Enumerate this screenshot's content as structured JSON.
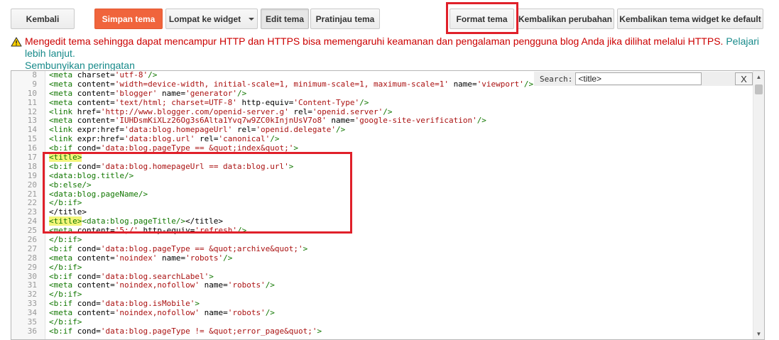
{
  "toolbar": {
    "back": "Kembali",
    "save": "Simpan tema",
    "jump": "Lompat ke widget",
    "edit": "Edit tema",
    "preview": "Pratinjau tema",
    "format": "Format tema",
    "revert": "Kembalikan perubahan",
    "reset_widgets": "Kembalikan tema widget ke default"
  },
  "warning": {
    "text": "Mengedit tema sehingga dapat mencampur HTTP dan HTTPS bisa memengaruhi keamanan dan pengalaman pengguna blog Anda jika dilihat melalui HTTPS.",
    "learn_more": "Pelajari lebih lanjut.",
    "hide": "Sembunyikan peringatan",
    "icon": "warning-triangle-icon"
  },
  "search": {
    "label": "Search:",
    "value": "<title>",
    "close": "X"
  },
  "lines": [
    {
      "n": "8",
      "html": "<span class='t'>&lt;meta</span> <span class='a'>charset=</span><span class='s'>'utf-8'</span><span class='t'>/&gt;</span>"
    },
    {
      "n": "9",
      "html": "<span class='t'>&lt;meta</span> <span class='a'>content=</span><span class='s'>'width=device-width, initial-scale=1, minimum-scale=1, maximum-scale=1'</span> <span class='a'>name=</span><span class='s'>'viewport'</span><span class='t'>/&gt;</span>"
    },
    {
      "n": "10",
      "html": "<span class='t'>&lt;meta</span> <span class='a'>content=</span><span class='s'>'blogger'</span> <span class='a'>name=</span><span class='s'>'generator'</span><span class='t'>/&gt;</span>"
    },
    {
      "n": "11",
      "html": "<span class='t'>&lt;meta</span> <span class='a'>content=</span><span class='s'>'text/html; charset=UTF-8'</span> <span class='a'>http-equiv=</span><span class='s'>'Content-Type'</span><span class='t'>/&gt;</span>"
    },
    {
      "n": "12",
      "html": "<span class='t'>&lt;link</span> <span class='a'>href=</span><span class='s'>'http://www.blogger.com/openid-server.g'</span> <span class='a'>rel=</span><span class='s'>'openid.server'</span><span class='t'>/&gt;</span>"
    },
    {
      "n": "13",
      "html": "<span class='t'>&lt;meta</span> <span class='a'>content=</span><span class='s'>'IUHDsmKiXLz26Og3s6Alta1Yvq7w9ZC0kInjnUsV7o8'</span> <span class='a'>name=</span><span class='s'>'google-site-verification'</span><span class='t'>/&gt;</span>"
    },
    {
      "n": "14",
      "html": "<span class='t'>&lt;link</span> <span class='a'>expr:href=</span><span class='s'>'data:blog.homepageUrl'</span> <span class='a'>rel=</span><span class='s'>'openid.delegate'</span><span class='t'>/&gt;</span>"
    },
    {
      "n": "15",
      "html": "<span class='t'>&lt;link</span> <span class='a'>expr:href=</span><span class='s'>'data:blog.url'</span> <span class='a'>rel=</span><span class='s'>'canonical'</span><span class='t'>/&gt;</span>"
    },
    {
      "n": "16",
      "html": "<span class='t'>&lt;b:if</span> <span class='a'>cond=</span><span class='s'>'data:blog.pageType == &amp;quot;index&amp;quot;'</span><span class='t'>&gt;</span>"
    },
    {
      "n": "17",
      "html": "<span class='t hl'>&lt;title&gt;</span>"
    },
    {
      "n": "18",
      "html": "<span class='t'>&lt;b:if</span> <span class='a'>cond=</span><span class='s'>'data:blog.homepageUrl == data:blog.url'</span><span class='t'>&gt;</span>"
    },
    {
      "n": "19",
      "html": "<span class='t'>&lt;data:blog.title/&gt;</span>"
    },
    {
      "n": "20",
      "html": "<span class='t'>&lt;b:else/&gt;</span>"
    },
    {
      "n": "21",
      "html": "<span class='t'>&lt;data:blog.pageName/&gt;</span>"
    },
    {
      "n": "22",
      "html": "<span class='t'>&lt;/b:if&gt;</span>"
    },
    {
      "n": "23",
      "html": "<span class='a'>&lt;/title&gt;</span>"
    },
    {
      "n": "24",
      "html": "<span class='t hl'>&lt;title&gt;</span><span class='t'>&lt;data:blog.pageTitle/&gt;</span><span class='a'>&lt;/title&gt;</span>"
    },
    {
      "n": "25",
      "html": "<span class='t'>&lt;meta</span> <span class='a'>content=</span><span class='s'>'5;/'</span> <span class='a'>http-equiv=</span><span class='s'>'refresh'</span><span class='t'>/&gt;</span>"
    },
    {
      "n": "26",
      "html": "<span class='t'>&lt;/b:if&gt;</span>"
    },
    {
      "n": "27",
      "html": "<span class='t'>&lt;b:if</span> <span class='a'>cond=</span><span class='s'>'data:blog.pageType == &amp;quot;archive&amp;quot;'</span><span class='t'>&gt;</span>"
    },
    {
      "n": "28",
      "html": "<span class='t'>&lt;meta</span> <span class='a'>content=</span><span class='s'>'noindex'</span> <span class='a'>name=</span><span class='s'>'robots'</span><span class='t'>/&gt;</span>"
    },
    {
      "n": "29",
      "html": "<span class='t'>&lt;/b:if&gt;</span>"
    },
    {
      "n": "30",
      "html": "<span class='t'>&lt;b:if</span> <span class='a'>cond=</span><span class='s'>'data:blog.searchLabel'</span><span class='t'>&gt;</span>"
    },
    {
      "n": "31",
      "html": "<span class='t'>&lt;meta</span> <span class='a'>content=</span><span class='s'>'noindex,nofollow'</span> <span class='a'>name=</span><span class='s'>'robots'</span><span class='t'>/&gt;</span>"
    },
    {
      "n": "32",
      "html": "<span class='t'>&lt;/b:if&gt;</span>"
    },
    {
      "n": "33",
      "html": "<span class='t'>&lt;b:if</span> <span class='a'>cond=</span><span class='s'>'data:blog.isMobile'</span><span class='t'>&gt;</span>"
    },
    {
      "n": "34",
      "html": "<span class='t'>&lt;meta</span> <span class='a'>content=</span><span class='s'>'noindex,nofollow'</span> <span class='a'>name=</span><span class='s'>'robots'</span><span class='t'>/&gt;</span>"
    },
    {
      "n": "35",
      "html": "<span class='t'>&lt;/b:if&gt;</span>"
    },
    {
      "n": "36",
      "html": "<span class='t'>&lt;b:if</span> <span class='a'>cond=</span><span class='s'>'data:blog.pageType != &amp;quot;error_page&amp;quot;'</span><span class='t'>&gt;</span>"
    }
  ],
  "colors": {
    "accent": "#f0643c",
    "annotation": "#e0202a",
    "highlight": "#f3f57a"
  }
}
